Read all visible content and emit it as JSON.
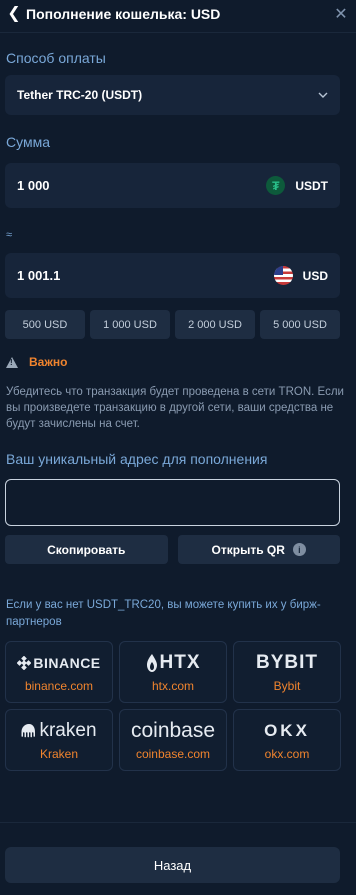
{
  "header": {
    "title": "Пополнение кошелька: USD",
    "back_glyph": "❮",
    "close_glyph": "✕"
  },
  "payment_method": {
    "label": "Способ оплаты",
    "selected": "Tether TRC-20 (USDT)"
  },
  "amount": {
    "label": "Сумма",
    "value": "1 000",
    "currency": "USDT",
    "icon": "tether-icon"
  },
  "conversion": {
    "approx_symbol": "≈",
    "value": "1 001.1",
    "currency": "USD",
    "icon": "us-flag-icon"
  },
  "presets": [
    "500 USD",
    "1 000 USD",
    "2 000 USD",
    "5 000 USD"
  ],
  "warning": {
    "title": "Важно",
    "text": "Убедитесь что транзакция будет проведена в сети TRON. Если вы произведете транзакцию в другой сети, ваши средства не будут зачислены на счет."
  },
  "address": {
    "label": "Ваш уникальный адрес для пополнения",
    "value": ""
  },
  "actions": {
    "copy": "Скопировать",
    "open_qr": "Открыть QR"
  },
  "exchanges": {
    "intro": "Если у вас нет USDT_TRC20, вы можете купить их у бирж-партнеров",
    "items": [
      {
        "logo": "BINANCE",
        "name": "binance.com"
      },
      {
        "logo": "HTX",
        "name": "htx.com"
      },
      {
        "logo": "BYBIT",
        "name": "Bybit"
      },
      {
        "logo": "kraken",
        "name": "Kraken"
      },
      {
        "logo": "coinbase",
        "name": "coinbase.com"
      },
      {
        "logo": "OKX",
        "name": "okx.com"
      }
    ]
  },
  "footer": {
    "back": "Назад"
  },
  "colors": {
    "background": "#0f1b2c",
    "accent_label": "#7aa8d8",
    "warning": "#f0842e"
  }
}
